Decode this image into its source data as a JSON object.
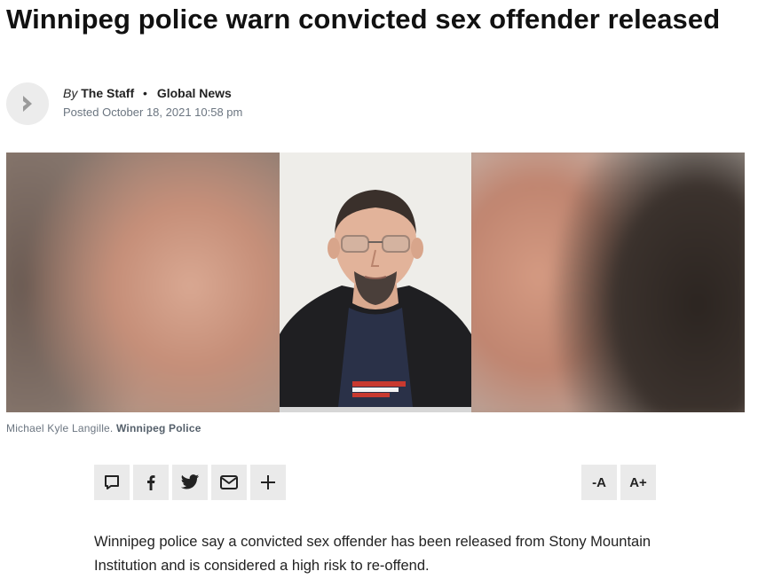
{
  "article": {
    "headline": "Winnipeg police warn convicted sex offender released",
    "byline": {
      "by": "By",
      "author": "The Staff",
      "separator": "•",
      "source": "Global News",
      "posted": "Posted October 18, 2021 10:58 pm"
    },
    "image": {
      "caption": "Michael Kyle Langille.",
      "credit": "Winnipeg Police"
    },
    "share": {
      "icons": [
        "comment-icon",
        "facebook-icon",
        "twitter-icon",
        "email-icon",
        "plus-icon"
      ]
    },
    "font_controls": {
      "decrease_label": "-A",
      "increase_label": "A+"
    },
    "body": "Winnipeg police say a convicted sex offender has been released from Stony Mountain Institution and is considered a high risk to re-offend."
  },
  "colors": {
    "headline": "#111111",
    "meta": "#6b7580",
    "button_bg": "#eaeaea"
  }
}
